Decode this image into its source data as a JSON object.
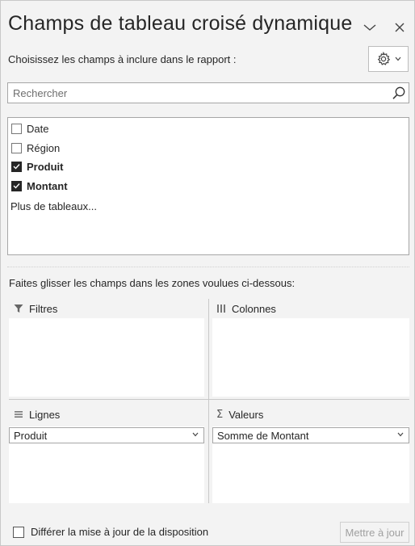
{
  "header": {
    "title": "Champs de tableau croisé dynamique",
    "subtitle": "Choisissez les champs à inclure dans le rapport :"
  },
  "search": {
    "placeholder": "Rechercher",
    "value": ""
  },
  "fields": [
    {
      "label": "Date",
      "checked": false
    },
    {
      "label": "Région",
      "checked": false
    },
    {
      "label": "Produit",
      "checked": true
    },
    {
      "label": "Montant",
      "checked": true
    }
  ],
  "more_tables": "Plus de tableaux...",
  "areas_hint": "Faites glisser les champs dans les zones voulues ci-dessous:",
  "areas": {
    "filters": {
      "label": "Filtres",
      "items": []
    },
    "columns": {
      "label": "Colonnes",
      "items": []
    },
    "rows": {
      "label": "Lignes",
      "items": [
        "Produit"
      ]
    },
    "values": {
      "label": "Valeurs",
      "items": [
        "Somme de Montant"
      ]
    }
  },
  "footer": {
    "defer_label": "Différer la mise à jour de la disposition",
    "defer_checked": false,
    "update_label": "Mettre à jour"
  },
  "icons": {
    "collapse": "chevron-down-icon",
    "close": "close-icon",
    "settings": "gear-icon",
    "search": "search-icon",
    "filters": "funnel-icon",
    "columns": "columns-icon",
    "rows": "rows-icon",
    "values": "sigma-icon"
  }
}
